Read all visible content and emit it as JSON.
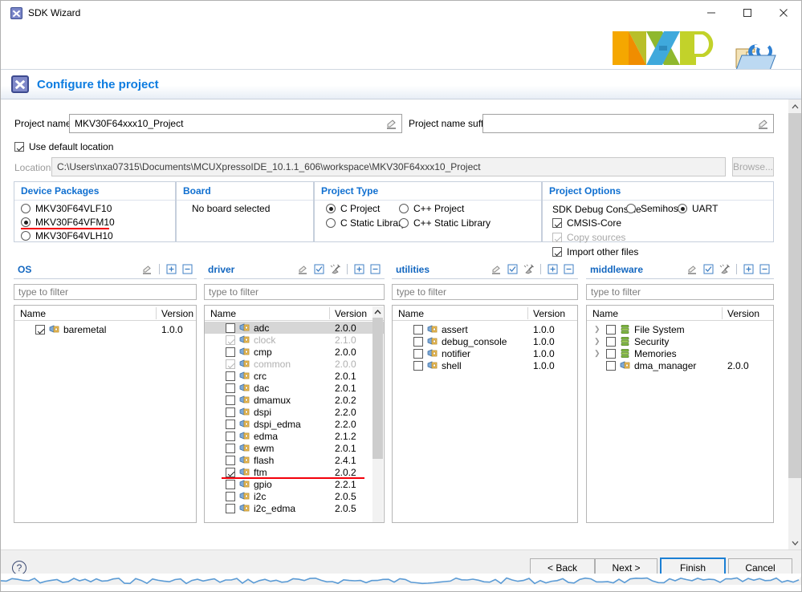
{
  "window": {
    "title": "SDK Wizard",
    "icon": "x-app-icon",
    "minimize_label": "minimize-icon",
    "maximize_label": "maximize-icon",
    "close_label": "close-icon"
  },
  "brand": {
    "logo": "NXP",
    "secondary_icon": "folder-c-icon"
  },
  "header": {
    "title": "Configure the project",
    "icon": "x-wizard-icon"
  },
  "project": {
    "name_label": "Project name:",
    "name_value": "MKV30F64xxx10_Project",
    "suffix_label": "Project name suffix:",
    "suffix_value": "",
    "use_default_location_label": "Use default location",
    "use_default_location_checked": true,
    "location_label": "Location:",
    "location_value": "C:\\Users\\nxa07315\\Documents\\MCUXpressoIDE_10.1.1_606\\workspace\\MKV30F64xxx10_Project",
    "browse_label": "Browse..."
  },
  "device_packages": {
    "title": "Device Packages",
    "options": [
      {
        "label": "MKV30F64VLF10",
        "selected": false,
        "annotated": false
      },
      {
        "label": "MKV30F64VFM10",
        "selected": true,
        "annotated": true
      },
      {
        "label": "MKV30F64VLH10",
        "selected": false,
        "annotated": false
      }
    ]
  },
  "board": {
    "title": "Board",
    "text": "No board selected"
  },
  "project_type": {
    "title": "Project Type",
    "options": [
      {
        "label": "C Project",
        "selected": true
      },
      {
        "label": "C++ Project",
        "selected": false
      },
      {
        "label": "C Static Library",
        "selected": false
      },
      {
        "label": "C++ Static Library",
        "selected": false
      }
    ]
  },
  "project_options": {
    "title": "Project Options",
    "debug_console_label": "SDK Debug Console",
    "debug_console_options": [
      {
        "label": "Semihost",
        "selected": false
      },
      {
        "label": "UART",
        "selected": true
      }
    ],
    "checks": [
      {
        "label": "CMSIS-Core",
        "checked": true,
        "disabled": false
      },
      {
        "label": "Copy sources",
        "checked": true,
        "disabled": true
      },
      {
        "label": "Import other files",
        "checked": true,
        "disabled": false
      }
    ]
  },
  "panels": {
    "filter_placeholder": "type to filter",
    "col_name": "Name",
    "col_version": "Version",
    "os": {
      "title": "OS",
      "tools": [
        "pencil-icon",
        "plus-box-icon",
        "minus-box-icon"
      ],
      "rows": [
        {
          "name": "baremetal",
          "version": "1.0.0",
          "checked": true,
          "disabled": false,
          "icon": "component-icon",
          "indent": 1
        }
      ]
    },
    "driver": {
      "title": "driver",
      "tools": [
        "pencil-icon",
        "checkbox-icon",
        "clear-icon",
        "plus-box-icon",
        "minus-box-icon"
      ],
      "rows": [
        {
          "name": "adc",
          "version": "2.0.0",
          "checked": false,
          "disabled": false,
          "selected": true,
          "icon": "component-icon",
          "indent": 1
        },
        {
          "name": "clock",
          "version": "2.1.0",
          "checked": true,
          "disabled": true,
          "icon": "component-icon",
          "indent": 1
        },
        {
          "name": "cmp",
          "version": "2.0.0",
          "checked": false,
          "disabled": false,
          "icon": "component-icon",
          "indent": 1
        },
        {
          "name": "common",
          "version": "2.0.0",
          "checked": true,
          "disabled": true,
          "icon": "component-icon",
          "indent": 1
        },
        {
          "name": "crc",
          "version": "2.0.1",
          "checked": false,
          "disabled": false,
          "icon": "component-icon",
          "indent": 1
        },
        {
          "name": "dac",
          "version": "2.0.1",
          "checked": false,
          "disabled": false,
          "icon": "component-icon",
          "indent": 1
        },
        {
          "name": "dmamux",
          "version": "2.0.2",
          "checked": false,
          "disabled": false,
          "icon": "component-icon",
          "indent": 1
        },
        {
          "name": "dspi",
          "version": "2.2.0",
          "checked": false,
          "disabled": false,
          "icon": "component-icon",
          "indent": 1
        },
        {
          "name": "dspi_edma",
          "version": "2.2.0",
          "checked": false,
          "disabled": false,
          "icon": "component-icon",
          "indent": 1
        },
        {
          "name": "edma",
          "version": "2.1.2",
          "checked": false,
          "disabled": false,
          "icon": "component-icon",
          "indent": 1
        },
        {
          "name": "ewm",
          "version": "2.0.1",
          "checked": false,
          "disabled": false,
          "icon": "component-icon",
          "indent": 1
        },
        {
          "name": "flash",
          "version": "2.4.1",
          "checked": false,
          "disabled": false,
          "icon": "component-icon",
          "indent": 1
        },
        {
          "name": "ftm",
          "version": "2.0.2",
          "checked": true,
          "disabled": false,
          "annotated": true,
          "icon": "component-icon",
          "indent": 1
        },
        {
          "name": "gpio",
          "version": "2.2.1",
          "checked": false,
          "disabled": false,
          "icon": "component-icon",
          "indent": 1
        },
        {
          "name": "i2c",
          "version": "2.0.5",
          "checked": false,
          "disabled": false,
          "icon": "component-icon",
          "indent": 1
        },
        {
          "name": "i2c_edma",
          "version": "2.0.5",
          "checked": false,
          "disabled": false,
          "icon": "component-icon",
          "indent": 1
        }
      ]
    },
    "utilities": {
      "title": "utilities",
      "tools": [
        "pencil-icon",
        "checkbox-icon",
        "clear-icon",
        "plus-box-icon",
        "minus-box-icon"
      ],
      "rows": [
        {
          "name": "assert",
          "version": "1.0.0",
          "checked": false,
          "disabled": false,
          "icon": "component-icon",
          "indent": 1
        },
        {
          "name": "debug_console",
          "version": "1.0.0",
          "checked": false,
          "disabled": false,
          "icon": "component-icon",
          "indent": 1
        },
        {
          "name": "notifier",
          "version": "1.0.0",
          "checked": false,
          "disabled": false,
          "icon": "component-icon",
          "indent": 1
        },
        {
          "name": "shell",
          "version": "1.0.0",
          "checked": false,
          "disabled": false,
          "icon": "component-icon",
          "indent": 1
        }
      ]
    },
    "middleware": {
      "title": "middleware",
      "tools": [
        "pencil-icon",
        "checkbox-icon",
        "clear-icon",
        "plus-box-icon",
        "minus-box-icon"
      ],
      "rows": [
        {
          "name": "File System",
          "version": "",
          "checked": false,
          "disabled": false,
          "icon": "stack-icon",
          "expandable": true,
          "indent": 0
        },
        {
          "name": "Security",
          "version": "",
          "checked": false,
          "disabled": false,
          "icon": "stack-icon",
          "expandable": true,
          "indent": 0
        },
        {
          "name": "Memories",
          "version": "",
          "checked": false,
          "disabled": false,
          "icon": "stack-icon",
          "expandable": true,
          "indent": 0
        },
        {
          "name": "dma_manager",
          "version": "2.0.0",
          "checked": false,
          "disabled": false,
          "icon": "component-icon",
          "expandable": false,
          "indent": 0
        }
      ]
    }
  },
  "footer": {
    "help_label": "?",
    "back_label": "< Back",
    "next_label": "Next >",
    "finish_label": "Finish",
    "cancel_label": "Cancel"
  },
  "colors": {
    "accent_blue": "#0d7ce0",
    "group_title_blue": "#0f6fd0",
    "annotation_red": "#f3000a",
    "default_button_border": "#1a7fd4"
  }
}
